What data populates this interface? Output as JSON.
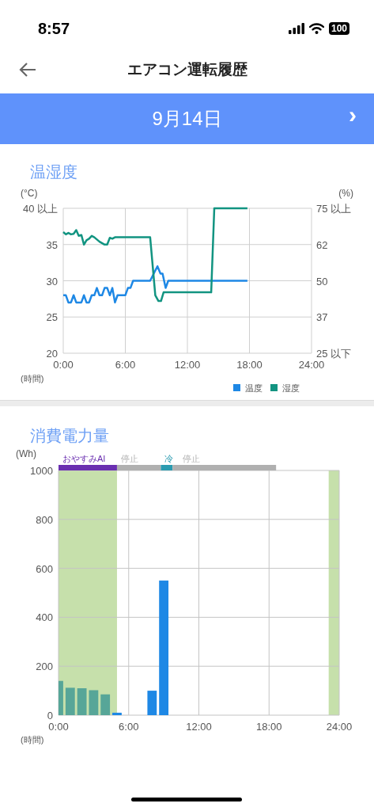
{
  "status_bar": {
    "time": "8:57",
    "battery": "100"
  },
  "header": {
    "title": "エアコン運転履歴"
  },
  "date_bar": {
    "date": "9月14日",
    "next": "›"
  },
  "climate": {
    "title": "温湿度",
    "chart_data": {
      "type": "line",
      "grid": true,
      "legend": "bottom-right",
      "xlabel": "(時間)",
      "ylabel": "(°C)",
      "y2label": "(%)",
      "xlim": [
        0,
        24
      ],
      "ylim": [
        20,
        40
      ],
      "y2lim": [
        25,
        75
      ],
      "xticks": [
        {
          "value": 0,
          "label": "0:00"
        },
        {
          "value": 6,
          "label": "6:00"
        },
        {
          "value": 12,
          "label": "12:00"
        },
        {
          "value": 18,
          "label": "18:00"
        },
        {
          "value": 24,
          "label": "24:00"
        }
      ],
      "yticks": [
        {
          "value": 40,
          "label": "40 以上"
        },
        {
          "value": 35,
          "label": "35"
        },
        {
          "value": 30,
          "label": "30"
        },
        {
          "value": 25,
          "label": "25"
        },
        {
          "value": 20,
          "label": "20"
        }
      ],
      "y2ticks": [
        {
          "value": 75,
          "label": "75 以上"
        },
        {
          "value": 62.5,
          "label": "62"
        },
        {
          "value": 50,
          "label": "50"
        },
        {
          "value": 37.5,
          "label": "37"
        },
        {
          "value": 25,
          "label": "25 以下"
        }
      ],
      "series": [
        {
          "name": "温度",
          "color": "#1e88e5",
          "x": [
            0,
            0.25,
            0.5,
            0.75,
            1,
            1.25,
            1.75,
            2,
            2.25,
            2.5,
            2.75,
            3,
            3.25,
            3.5,
            3.75,
            4,
            4.25,
            4.5,
            4.75,
            5,
            5.25,
            6,
            6.25,
            6.5,
            6.75,
            8.4,
            9.1,
            9.4,
            9.6,
            9.9,
            10.15,
            17.8
          ],
          "values": [
            28,
            28,
            27,
            27,
            28,
            27,
            27,
            28,
            27,
            27,
            28,
            28,
            29,
            28,
            28,
            29,
            29,
            28,
            29,
            27,
            28,
            28,
            29,
            29,
            30,
            30,
            32,
            31,
            31,
            29,
            30,
            30
          ]
        },
        {
          "name": "湿度",
          "color": "#129481",
          "axis": "y2",
          "x": [
            0,
            0.25,
            0.5,
            0.75,
            1,
            1.25,
            1.5,
            1.75,
            2,
            2.25,
            2.5,
            2.75,
            3,
            3.5,
            4,
            4.25,
            4.5,
            4.75,
            5,
            8.4,
            8.9,
            9.2,
            9.45,
            9.7,
            14.3,
            14.6,
            17.8
          ],
          "values": [
            66.8,
            66,
            66.5,
            66,
            66.2,
            67.5,
            65.5,
            65.8,
            62.5,
            64,
            64.5,
            65.5,
            65,
            63.5,
            62.5,
            62.5,
            64.8,
            64.5,
            65,
            65,
            45,
            43,
            43,
            46,
            46,
            75,
            75
          ]
        }
      ]
    }
  },
  "energy": {
    "title": "消費電力量",
    "mode_timeline": [
      {
        "label": "おやすみAI",
        "color": "#6a2fb0"
      },
      {
        "label": "停止",
        "color": "#b0b0b0"
      },
      {
        "label": "冷",
        "color": "#2a9bb0"
      },
      {
        "label": "停止",
        "color": "#b0b0b0"
      }
    ],
    "chart_data": {
      "type": "bar",
      "grid": true,
      "xlabel": "(時間)",
      "ylabel": "(Wh)",
      "xlim": [
        0,
        24
      ],
      "ylim": [
        0,
        1000
      ],
      "xticks": [
        {
          "value": 0,
          "label": "0:00"
        },
        {
          "value": 6,
          "label": "6:00"
        },
        {
          "value": 12,
          "label": "12:00"
        },
        {
          "value": 18,
          "label": "18:00"
        },
        {
          "value": 24,
          "label": "24:00"
        }
      ],
      "yticks": [
        0,
        200,
        400,
        600,
        800,
        1000
      ],
      "x": [
        0,
        1,
        2,
        3,
        4,
        5,
        8,
        9
      ],
      "series": [
        {
          "color": "#57a698",
          "values": [
            140,
            112,
            110,
            102,
            85,
            null,
            null,
            null
          ]
        },
        {
          "color": "#1e88e5",
          "values": [
            null,
            null,
            null,
            null,
            null,
            10,
            100,
            550
          ]
        }
      ],
      "bands": [
        {
          "axis": "x",
          "from": 0,
          "to": 5,
          "color": "#c6e0ab"
        },
        {
          "axis": "x",
          "from": 23.1,
          "to": 24,
          "color": "#c6e0ab"
        }
      ]
    }
  }
}
